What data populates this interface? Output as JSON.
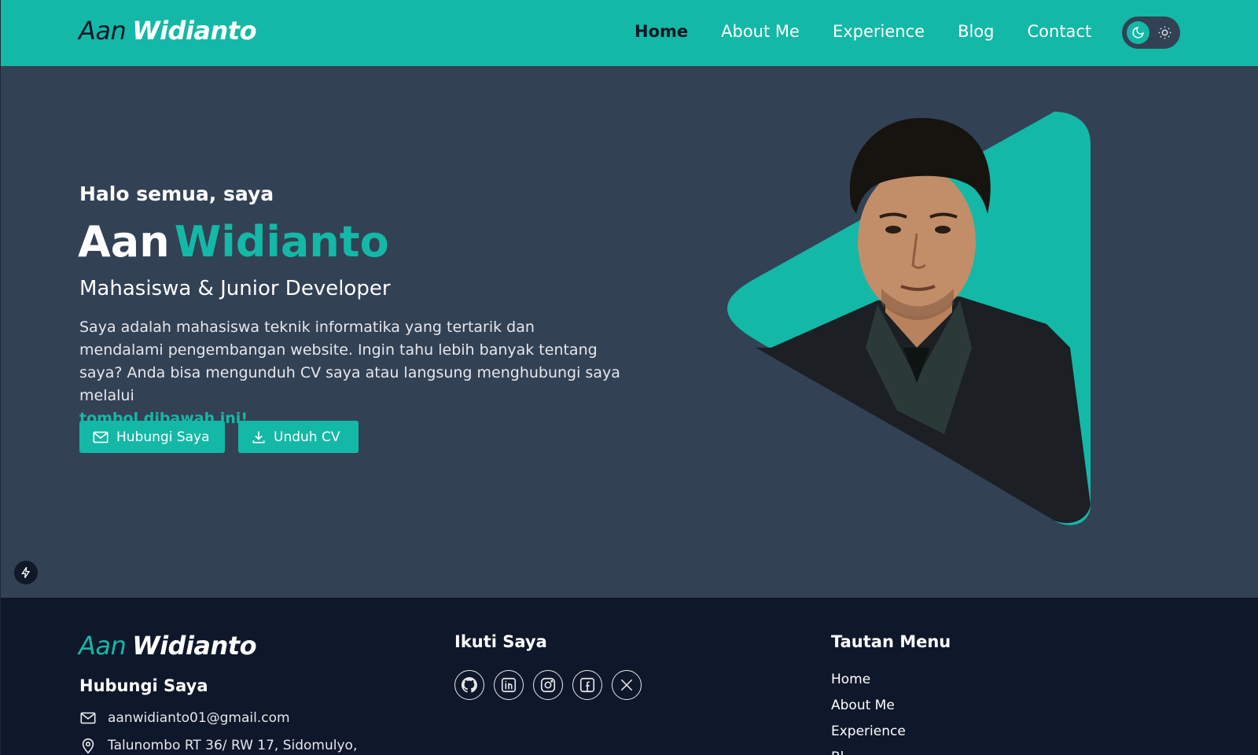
{
  "header": {
    "logo_light": "Aan",
    "logo_bold": "Widianto",
    "nav": [
      "Home",
      "About Me",
      "Experience",
      "Blog",
      "Contact"
    ],
    "active_nav": "Home",
    "theme_toggle": {
      "icons": [
        "moon-icon",
        "sun-icon"
      ],
      "active": "dark"
    }
  },
  "hero": {
    "greeting": "Halo semua, saya",
    "name_first": "Aan",
    "name_last": "Widianto",
    "role": "Mahasiswa & Junior Developer",
    "description": "Saya adalah mahasiswa teknik informatika yang tertarik dan mendalami pengembangan website. Ingin tahu lebih banyak tentang saya? Anda bisa mengunduh CV saya atau langsung menghubungi saya melalui",
    "description_link": "tombol dibawah ini!",
    "buttons": {
      "contact": "Hubungi Saya",
      "download": "Unduh CV"
    },
    "portrait_accent": "#14b8a6"
  },
  "footer": {
    "logo_light": "Aan",
    "logo_bold": "Widianto",
    "contact_heading": "Hubungi Saya",
    "email": "aanwidianto01@gmail.com",
    "address": "Talunombo RT 36/ RW 17, Sidomulyo,",
    "social_heading": "Ikuti Saya",
    "social_icons": [
      "github-icon",
      "linkedin-icon",
      "instagram-icon",
      "facebook-icon",
      "x-icon"
    ],
    "links_heading": "Tautan Menu",
    "links": [
      "Home",
      "About Me",
      "Experience",
      "Bl"
    ]
  },
  "colors": {
    "accent": "#14b8a6",
    "hero_bg": "#334155",
    "footer_bg": "#0f172a",
    "dark_text": "#111827"
  }
}
